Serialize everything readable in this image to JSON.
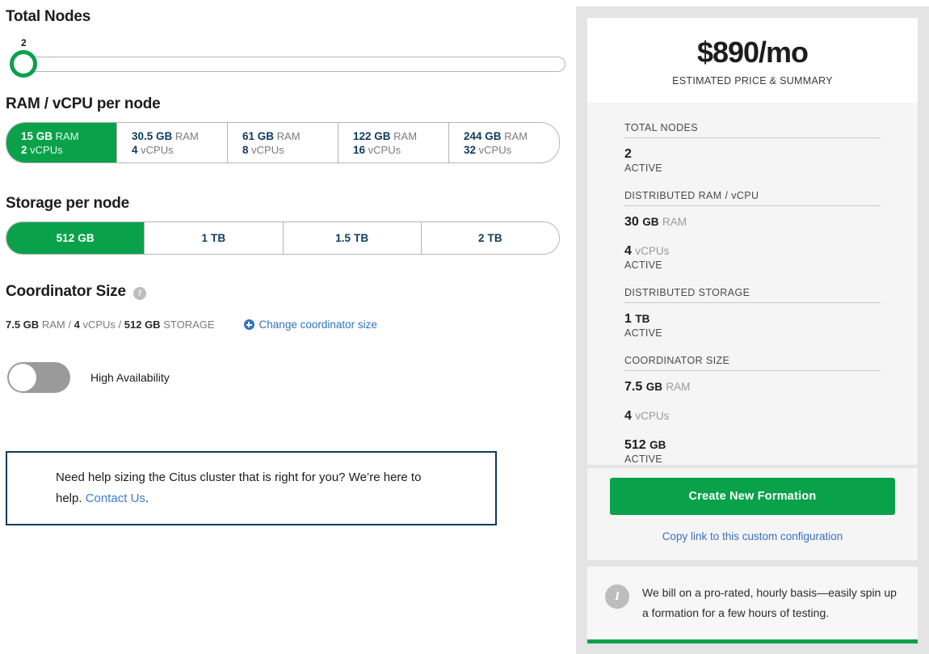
{
  "config": {
    "nodes": {
      "title": "Total Nodes",
      "value": "2"
    },
    "ram_vcpu": {
      "title": "RAM / vCPU per node",
      "options": [
        {
          "size": "15 GB",
          "size_unit": "RAM",
          "cpu": "2",
          "cpu_unit": "vCPUs",
          "selected": true
        },
        {
          "size": "30.5 GB",
          "size_unit": "RAM",
          "cpu": "4",
          "cpu_unit": "vCPUs",
          "selected": false
        },
        {
          "size": "61 GB",
          "size_unit": "RAM",
          "cpu": "8",
          "cpu_unit": "vCPUs",
          "selected": false
        },
        {
          "size": "122 GB",
          "size_unit": "RAM",
          "cpu": "16",
          "cpu_unit": "vCPUs",
          "selected": false
        },
        {
          "size": "244 GB",
          "size_unit": "RAM",
          "cpu": "32",
          "cpu_unit": "vCPUs",
          "selected": false
        }
      ]
    },
    "storage": {
      "title": "Storage per node",
      "options": [
        {
          "label": "512 GB",
          "selected": true
        },
        {
          "label": "1 TB",
          "selected": false
        },
        {
          "label": "1.5 TB",
          "selected": false
        },
        {
          "label": "2 TB",
          "selected": false
        }
      ]
    },
    "coordinator": {
      "title": "Coordinator Size",
      "help_glyph": "?",
      "ram_value": "7.5 GB",
      "ram_unit": "RAM",
      "sep1": "/",
      "cpu_value": "4",
      "cpu_unit": "vCPUs",
      "sep2": "/",
      "storage_value": "512 GB",
      "storage_unit": "STORAGE",
      "change_link": "Change coordinator size"
    },
    "high_availability": {
      "label": "High Availability",
      "state": "off"
    },
    "callout": {
      "text_before": "Need help sizing the Citus cluster that is right for you? We’re here to help. ",
      "link": "Contact Us",
      "text_after": "."
    }
  },
  "summary": {
    "price": "$890/mo",
    "price_caption": "ESTIMATED PRICE & SUMMARY",
    "groups": [
      {
        "label": "TOTAL NODES",
        "lines": [
          {
            "value": "2",
            "unit": "",
            "unit_style": "bold"
          }
        ],
        "state": "ACTIVE"
      },
      {
        "label": "DISTRIBUTED RAM / vCPU",
        "lines": [
          {
            "value": "30",
            "unit": "GB",
            "unit2": "RAM",
            "unit_style": "bold"
          },
          {
            "value": "4",
            "unit": "vCPUs",
            "unit_style": "light"
          }
        ],
        "state": "ACTIVE"
      },
      {
        "label": "DISTRIBUTED STORAGE",
        "lines": [
          {
            "value": "1",
            "unit": "TB",
            "unit_style": "bold"
          }
        ],
        "state": "ACTIVE"
      },
      {
        "label": "COORDINATOR SIZE",
        "lines": [
          {
            "value": "7.5",
            "unit": "GB",
            "unit2": "RAM",
            "unit_style": "bold"
          },
          {
            "value": "4",
            "unit": "vCPUs",
            "unit_style": "light"
          },
          {
            "value": "512",
            "unit": "GB",
            "unit_style": "bold"
          }
        ],
        "state": "ACTIVE"
      }
    ],
    "cta_label": "Create New Formation",
    "copy_link_label": "Copy link to this custom configuration",
    "note_icon_glyph": "I",
    "note_text": "We bill on a pro-rated, hourly basis—easily spin up a formation for a few hours of testing."
  },
  "colors": {
    "green": "#0aa14b",
    "navy": "#103d63",
    "link_blue": "#3b7dd8",
    "panel_gray": "#e4e4e4",
    "body_gray": "#f5f5f5"
  }
}
